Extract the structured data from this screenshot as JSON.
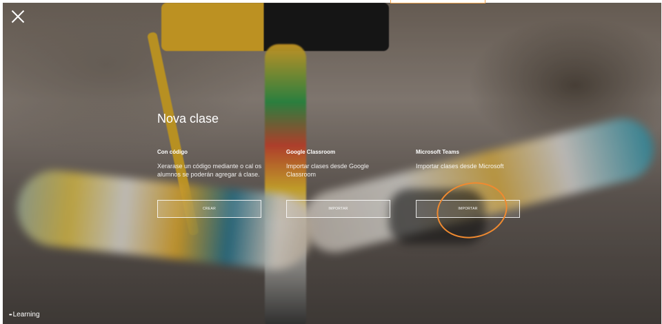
{
  "title": "Nova clase",
  "options": [
    {
      "name": "Con código",
      "description": "Xerarase un código mediante o cal os alumnos se poderán agregar á clase.",
      "button": "CREAR"
    },
    {
      "name": "Google Classroom",
      "description": "Importar clases desde Google Classroom",
      "button": "IMPORTAR"
    },
    {
      "name": "Microsoft Teams",
      "description": "Importar clases desde Microsoft",
      "button": "IMPORTAR"
    }
  ],
  "footer": {
    "brand_dots": "••",
    "brand": "Learning"
  },
  "colors": {
    "highlight": "#f08a30",
    "accent": "#e6b12a"
  }
}
